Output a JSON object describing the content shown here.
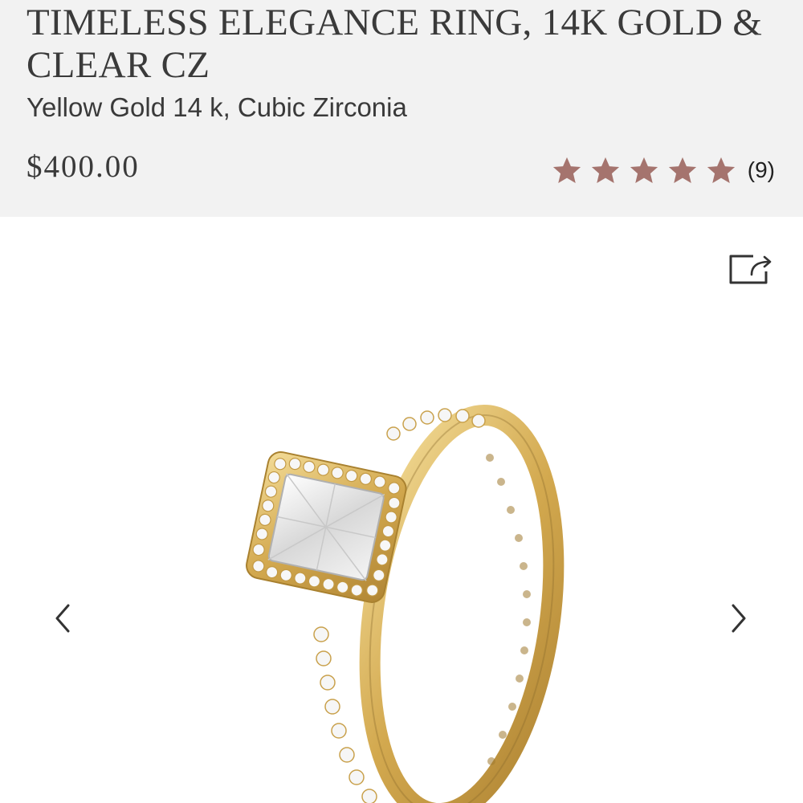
{
  "product": {
    "title": "TIMELESS ELEGANCE RING, 14K GOLD & CLEAR CZ",
    "subtitle": "Yellow Gold 14 k, Cubic Zirconia",
    "price": "$400.00",
    "rating": {
      "stars": 5,
      "max_stars": 5,
      "count_label": "(9)"
    }
  },
  "icons": {
    "share": "share-icon",
    "prev": "chevron-left-icon",
    "next": "chevron-right-icon",
    "star": "star-icon"
  },
  "colors": {
    "header_bg": "#f2f2f2",
    "star": "#a5746e",
    "text": "#3a3a3a",
    "gold": "#d9b65e"
  },
  "gallery": {
    "image_label": "ring-product-image"
  }
}
